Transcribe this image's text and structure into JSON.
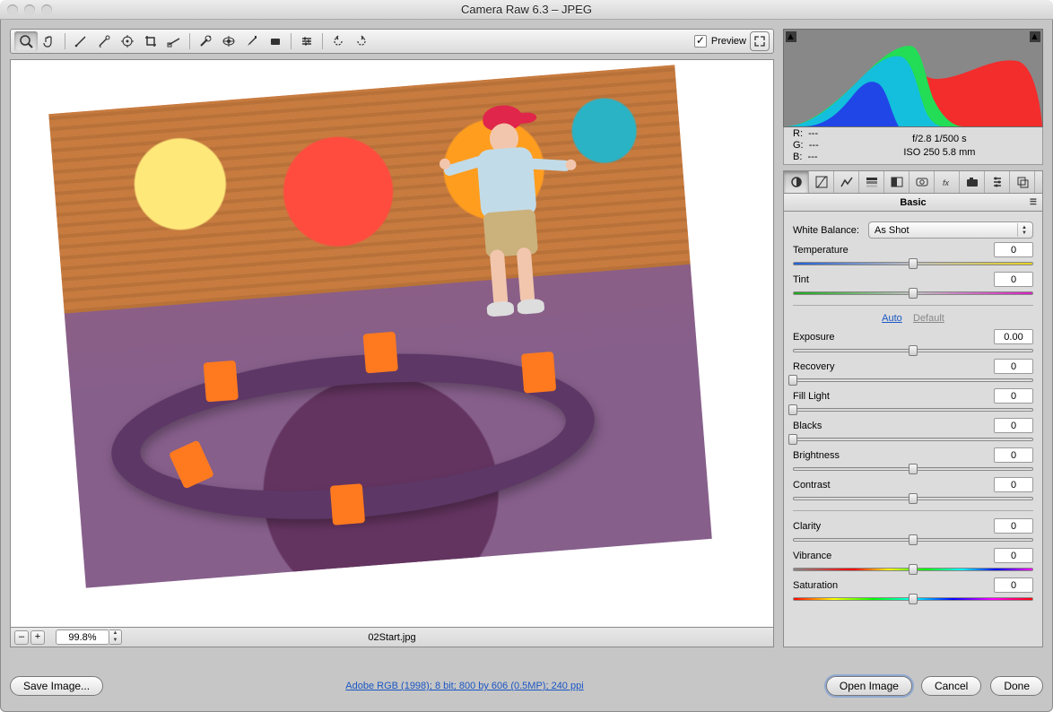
{
  "window": {
    "title": "Camera Raw 6.3  –  JPEG"
  },
  "toolbar": {
    "tools": [
      "zoom",
      "hand",
      "white-balance",
      "color-sampler",
      "targeted-adjust",
      "crop",
      "straighten",
      "spot-removal",
      "red-eye",
      "adjustment-brush",
      "graduated-filter",
      "preferences",
      "rotate-ccw",
      "rotate-cw"
    ],
    "preview_label": "Preview",
    "preview_checked": true
  },
  "status": {
    "zoom_minus": "–",
    "zoom_plus": "+",
    "zoom_value": "99.8%",
    "filename": "02Start.jpg"
  },
  "exif": {
    "r_label": "R:",
    "r_val": "---",
    "g_label": "G:",
    "g_val": "---",
    "b_label": "B:",
    "b_val": "---",
    "line1": "f/2.8   1/500 s",
    "line2": "ISO 250   5.8 mm"
  },
  "tabs": {
    "names": [
      "basic",
      "tone-curve",
      "detail",
      "hsl",
      "split-toning",
      "lens-corrections",
      "effects",
      "camera-calibration",
      "presets",
      "snapshots"
    ],
    "active": 0
  },
  "panel": {
    "title": "Basic",
    "wb_label": "White Balance:",
    "wb_value": "As Shot",
    "auto_label": "Auto",
    "default_label": "Default",
    "sliders": {
      "temperature": {
        "label": "Temperature",
        "value": "0",
        "pos": 50,
        "rail": "rail-temp"
      },
      "tint": {
        "label": "Tint",
        "value": "0",
        "pos": 50,
        "rail": "rail-tint"
      },
      "exposure": {
        "label": "Exposure",
        "value": "0.00",
        "pos": 50,
        "rail": "rail-plain"
      },
      "recovery": {
        "label": "Recovery",
        "value": "0",
        "pos": 0,
        "rail": "rail-plain"
      },
      "filllight": {
        "label": "Fill Light",
        "value": "0",
        "pos": 0,
        "rail": "rail-plain"
      },
      "blacks": {
        "label": "Blacks",
        "value": "0",
        "pos": 0,
        "rail": "rail-plain"
      },
      "brightness": {
        "label": "Brightness",
        "value": "0",
        "pos": 50,
        "rail": "rail-plain"
      },
      "contrast": {
        "label": "Contrast",
        "value": "0",
        "pos": 50,
        "rail": "rail-plain"
      },
      "clarity": {
        "label": "Clarity",
        "value": "0",
        "pos": 50,
        "rail": "rail-plain"
      },
      "vibrance": {
        "label": "Vibrance",
        "value": "0",
        "pos": 50,
        "rail": "rail-vib"
      },
      "saturation": {
        "label": "Saturation",
        "value": "0",
        "pos": 50,
        "rail": "rail-sat"
      }
    }
  },
  "footer": {
    "save": "Save Image...",
    "metadata_link": "Adobe RGB (1998); 8 bit; 800 by 606 (0.5MP); 240 ppi",
    "open": "Open Image",
    "cancel": "Cancel",
    "done": "Done"
  }
}
